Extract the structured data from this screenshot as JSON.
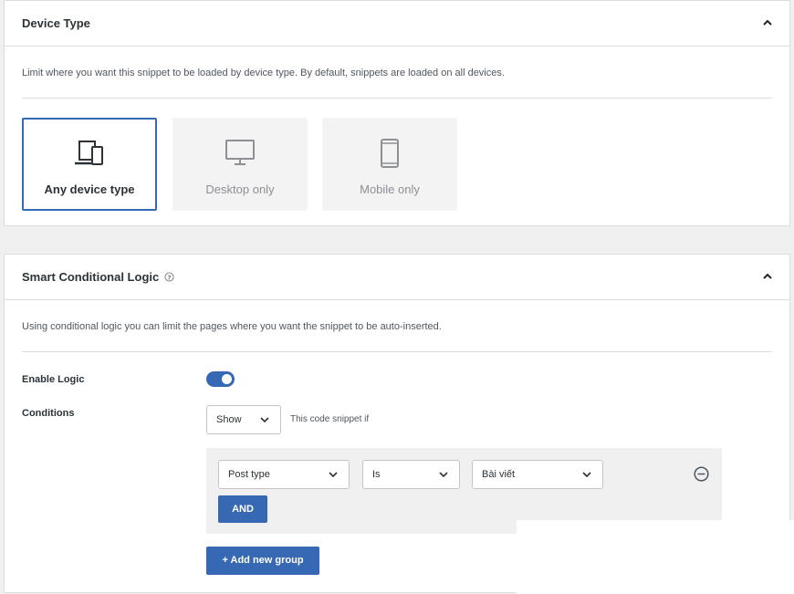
{
  "device_type": {
    "title": "Device Type",
    "description": "Limit where you want this snippet to be loaded by device type. By default, snippets are loaded on all devices.",
    "options": [
      {
        "label": "Any device type",
        "icon": "devices-icon",
        "selected": true
      },
      {
        "label": "Desktop only",
        "icon": "desktop-icon",
        "selected": false
      },
      {
        "label": "Mobile only",
        "icon": "mobile-icon",
        "selected": false
      }
    ]
  },
  "smart_logic": {
    "title": "Smart Conditional Logic",
    "description": "Using conditional logic you can limit the pages where you want the snippet to be auto-inserted.",
    "enable_label": "Enable Logic",
    "enabled": true,
    "conditions_label": "Conditions",
    "show_select": "Show",
    "show_suffix": "This code snippet if",
    "rule": {
      "field": "Post type",
      "operator": "Is",
      "value": "Bài viết"
    },
    "and_button": "AND",
    "add_group_button": "+ Add new group"
  },
  "colors": {
    "accent": "#3768b3",
    "panel_border": "#dcdcde",
    "background": "#f0f0f1"
  }
}
